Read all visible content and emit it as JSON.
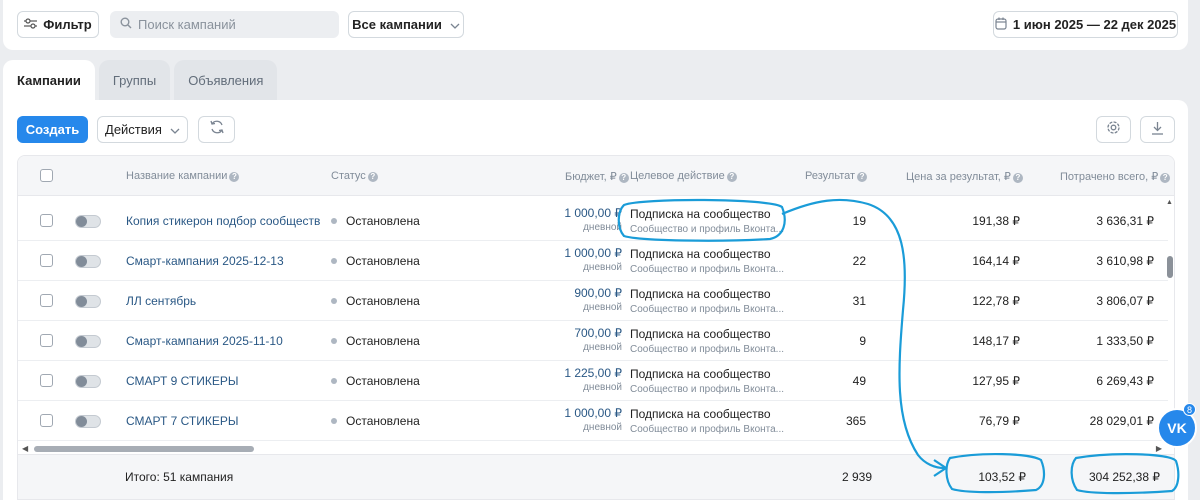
{
  "toolbar": {
    "filter_label": "Фильтр",
    "search_placeholder": "Поиск кампаний",
    "campaigns_select": "Все кампании",
    "date_range": "1 июн 2025 — 22 дек 2025"
  },
  "tabs": [
    {
      "label": "Кампании",
      "active": true
    },
    {
      "label": "Группы",
      "active": false
    },
    {
      "label": "Объявления",
      "active": false
    }
  ],
  "actions": {
    "create_label": "Создать",
    "actions_label": "Действия"
  },
  "icons": {
    "filter": "sliders-icon",
    "search": "search-icon",
    "calendar": "calendar-icon",
    "refresh": "refresh-icon",
    "settings": "gear-icon",
    "download": "download-icon"
  },
  "columns": {
    "name": "Название кампании",
    "status": "Статус",
    "budget": "Бюджет, ₽",
    "target": "Целевое действие",
    "result": "Результат",
    "price": "Цена за результат, ₽",
    "spent": "Потрачено всего, ₽"
  },
  "rows": [
    {
      "name": "Копия стикерон подбор сообществ",
      "status": "Остановлена",
      "budget": "1 000,00 ₽",
      "period": "дневной",
      "target": "Подписка на сообщество",
      "target_sub": "Сообщество и профиль Вконта...",
      "result": "19",
      "price": "191,38 ₽",
      "spent": "3 636,31 ₽"
    },
    {
      "name": "Смарт-кампания 2025-12-13",
      "status": "Остановлена",
      "budget": "1 000,00 ₽",
      "period": "дневной",
      "target": "Подписка на сообщество",
      "target_sub": "Сообщество и профиль Вконта...",
      "result": "22",
      "price": "164,14 ₽",
      "spent": "3 610,98 ₽"
    },
    {
      "name": "ЛЛ сентябрь",
      "status": "Остановлена",
      "budget": "900,00 ₽",
      "period": "дневной",
      "target": "Подписка на сообщество",
      "target_sub": "Сообщество и профиль Вконта...",
      "result": "31",
      "price": "122,78 ₽",
      "spent": "3 806,07 ₽"
    },
    {
      "name": "Смарт-кампания 2025-11-10",
      "status": "Остановлена",
      "budget": "700,00 ₽",
      "period": "дневной",
      "target": "Подписка на сообщество",
      "target_sub": "Сообщество и профиль Вконта...",
      "result": "9",
      "price": "148,17 ₽",
      "spent": "1 333,50 ₽"
    },
    {
      "name": "СМАРТ 9 СТИКЕРЫ",
      "status": "Остановлена",
      "budget": "1 225,00 ₽",
      "period": "дневной",
      "target": "Подписка на сообщество",
      "target_sub": "Сообщество и профиль Вконта...",
      "result": "49",
      "price": "127,95 ₽",
      "spent": "6 269,43 ₽"
    },
    {
      "name": "СМАРТ 7 СТИКЕРЫ",
      "status": "Остановлена",
      "budget": "1 000,00 ₽",
      "period": "дневной",
      "target": "Подписка на сообщество",
      "target_sub": "Сообщество и профиль Вконта...",
      "result": "365",
      "price": "76,79 ₽",
      "spent": "28 029,01 ₽"
    }
  ],
  "totals": {
    "label": "Итого: 51 кампания",
    "result": "2 939",
    "price": "103,52 ₽",
    "spent": "304 252,38 ₽"
  },
  "vk_widget": {
    "logo": "VK",
    "badge_count": "8"
  },
  "colors": {
    "accent": "#2688eb",
    "link": "#2a5885",
    "annotation": "#1a9cd8"
  }
}
